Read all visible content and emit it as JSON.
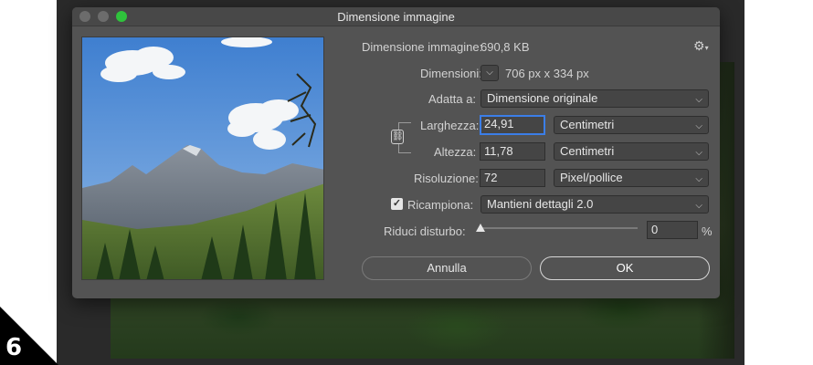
{
  "step_number": "6",
  "dialog": {
    "title": "Dimensione immagine",
    "image_size_label": "Dimensione immagine:",
    "image_size_value": "690,8 KB",
    "gear_icon": "gear-icon",
    "dimensions_label": "Dimensioni:",
    "dimensions_value": "706 px x 334 px",
    "fit_to_label": "Adatta a:",
    "fit_to_value": "Dimensione originale",
    "width_label": "Larghezza:",
    "width_value": "24,91",
    "width_unit": "Centimetri",
    "height_label": "Altezza:",
    "height_value": "11,78",
    "height_unit": "Centimetri",
    "resolution_label": "Risoluzione:",
    "resolution_value": "72",
    "resolution_unit": "Pixel/pollice",
    "resample_label": "Ricampiona:",
    "resample_checked": true,
    "resample_value": "Mantieni dettagli 2.0",
    "noise_label": "Riduci disturbo:",
    "noise_value": "0",
    "noise_unit": "%",
    "noise_level": 0,
    "cancel_label": "Annulla",
    "ok_label": "OK"
  },
  "colors": {
    "dialog_bg": "#535353",
    "focus_ring": "#3b7ee8",
    "traffic_green": "#2fc33c"
  }
}
